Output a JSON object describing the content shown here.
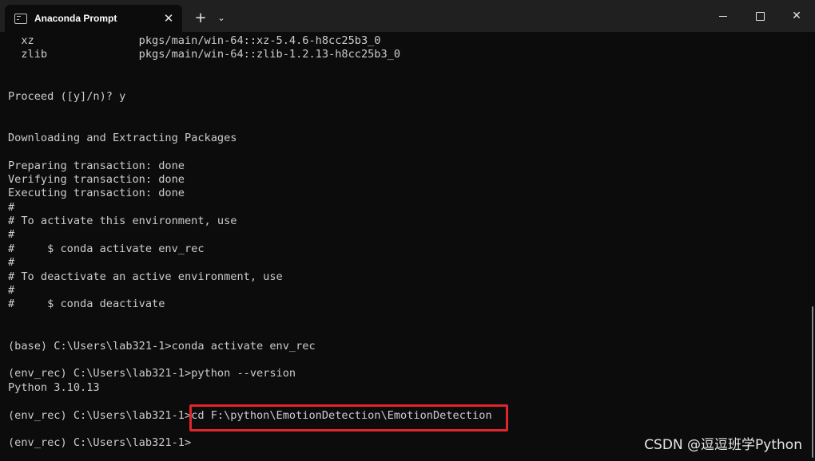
{
  "window": {
    "tab_title": "Anaconda Prompt",
    "tab_close": "✕",
    "new_tab": "+",
    "dropdown": "⌄",
    "close": "✕"
  },
  "terminal": {
    "lines": [
      "  xz                pkgs/main/win-64::xz-5.4.6-h8cc25b3_0",
      "  zlib              pkgs/main/win-64::zlib-1.2.13-h8cc25b3_0",
      "",
      "",
      "Proceed ([y]/n)? y",
      "",
      "",
      "Downloading and Extracting Packages",
      "",
      "Preparing transaction: done",
      "Verifying transaction: done",
      "Executing transaction: done",
      "#",
      "# To activate this environment, use",
      "#",
      "#     $ conda activate env_rec",
      "#",
      "# To deactivate an active environment, use",
      "#",
      "#     $ conda deactivate",
      "",
      "",
      "(base) C:\\Users\\lab321-1>conda activate env_rec",
      "",
      "(env_rec) C:\\Users\\lab321-1>python --version",
      "Python 3.10.13",
      "",
      "(env_rec) C:\\Users\\lab321-1>cd F:\\python\\EmotionDetection\\EmotionDetection",
      "",
      "(env_rec) C:\\Users\\lab321-1>"
    ]
  },
  "watermark": "CSDN @逗逗班学Python",
  "colors": {
    "terminal_bg": "#0c0c0c",
    "titlebar_bg": "#202020",
    "text": "#cccccc",
    "highlight": "#e0252c"
  }
}
